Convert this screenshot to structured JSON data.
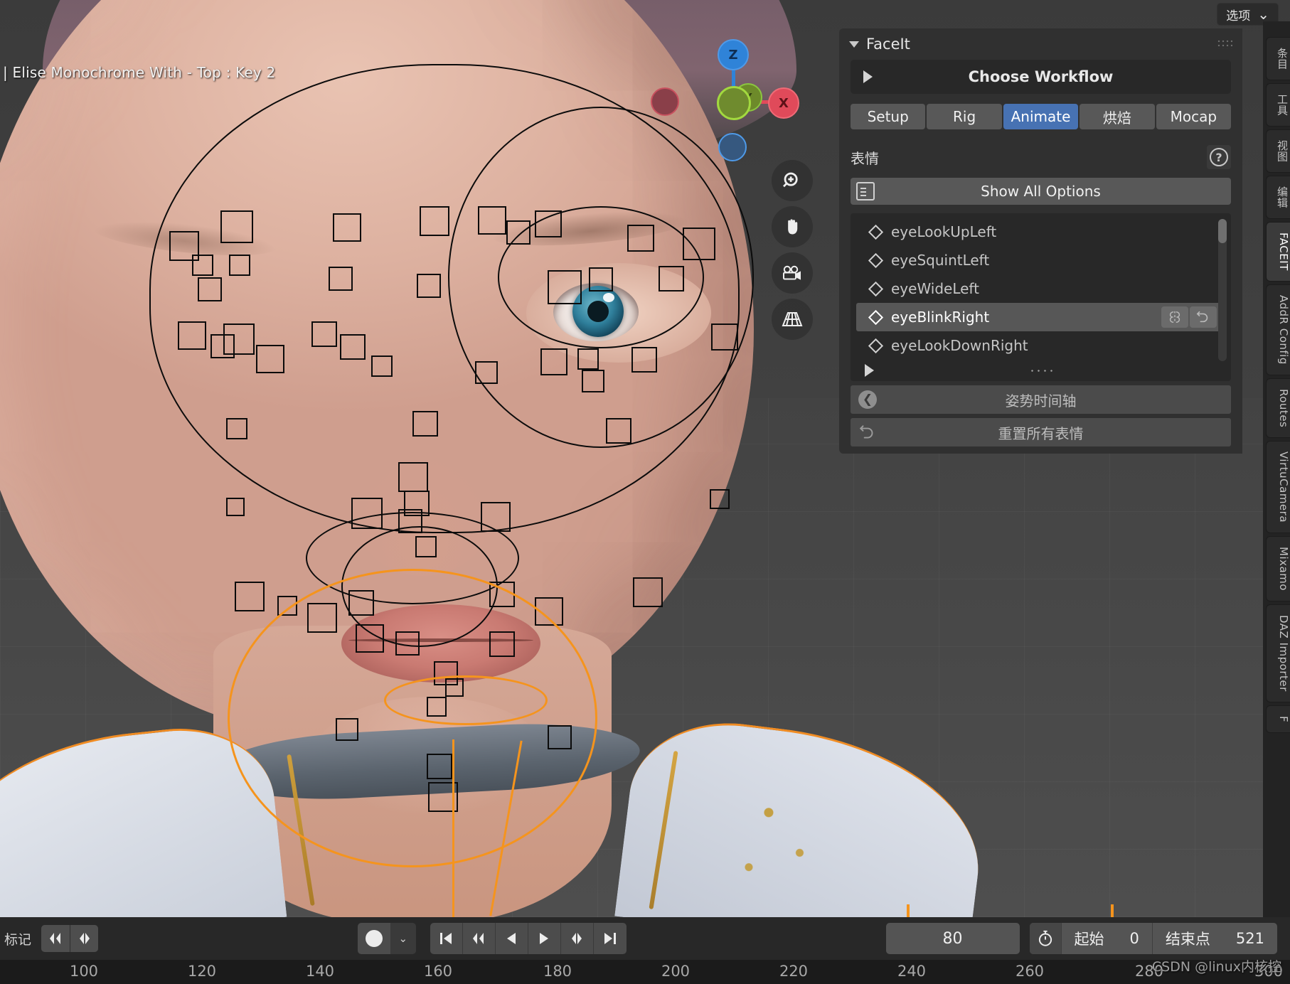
{
  "viewport": {
    "overlay_text": "| Elise Monochrome With - Top : Key 2",
    "gizmo": {
      "axis_z": "Z",
      "axis_y": "Y",
      "axis_x": "X",
      "color_z": "#2f83d8",
      "color_y": "#8bc63f",
      "color_x": "#e04a5a"
    },
    "nav_icons": [
      {
        "name": "zoom-icon",
        "glyph": "⌕"
      },
      {
        "name": "pan-hand-icon",
        "glyph": "✋"
      },
      {
        "name": "camera-view-icon",
        "glyph": "🎥"
      },
      {
        "name": "grid-perspective-icon",
        "glyph": "▦"
      }
    ]
  },
  "topbar": {
    "options_label": "选项",
    "options_chevron": "⌄"
  },
  "vertical_tabs": [
    {
      "label": "条目",
      "active": false
    },
    {
      "label": "工具",
      "active": false
    },
    {
      "label": "视图",
      "active": false
    },
    {
      "label": "编辑",
      "active": false
    },
    {
      "label": "FACEIT",
      "active": true
    },
    {
      "label": "AddR Config",
      "active": false
    },
    {
      "label": "Routes",
      "active": false
    },
    {
      "label": "VirtuCamera",
      "active": false
    },
    {
      "label": "Mixamo",
      "active": false
    },
    {
      "label": "DAZ Importer",
      "active": false
    },
    {
      "label": "F",
      "active": false
    }
  ],
  "panel": {
    "title": "FaceIt",
    "choose_workflow_label": "Choose Workflow",
    "tabs": [
      {
        "label": "Setup",
        "active": false
      },
      {
        "label": "Rig",
        "active": false
      },
      {
        "label": "Animate",
        "active": true
      },
      {
        "label": "烘焙",
        "active": false
      },
      {
        "label": "Mocap",
        "active": false
      }
    ],
    "section_title": "表情",
    "help_glyph": "?",
    "show_all_options_label": "Show All Options",
    "expressions": [
      {
        "label": "eyeLookUpLeft",
        "selected": false
      },
      {
        "label": "eyeSquintLeft",
        "selected": false
      },
      {
        "label": "eyeWideLeft",
        "selected": false
      },
      {
        "label": "eyeBlinkRight",
        "selected": true
      },
      {
        "label": "eyeLookDownRight",
        "selected": false
      }
    ],
    "row_buttons": [
      {
        "name": "mirror-icon",
        "glyph": "ΘΘ"
      },
      {
        "name": "reset-icon",
        "glyph": "↶"
      }
    ],
    "footer_buttons": [
      {
        "label": "姿势时间轴",
        "icon": "back-arrow-circle-icon"
      },
      {
        "label": "重置所有表情",
        "icon": "undo-arrow-icon"
      }
    ],
    "accent_color": "#4772b3"
  },
  "timeline": {
    "marker_label": "标记",
    "marker_buttons": [
      {
        "name": "jump-prev-marker-icon",
        "glyph": "◀◆"
      },
      {
        "name": "jump-next-marker-icon",
        "glyph": "◆▶"
      }
    ],
    "record_button": {
      "name": "auto-key-record-icon"
    },
    "record_dropdown": {
      "name": "record-options-chevron-icon",
      "glyph": "⌄"
    },
    "transport": [
      {
        "name": "jump-start-icon",
        "glyph": "|◀"
      },
      {
        "name": "prev-keyframe-icon",
        "glyph": "◀◆"
      },
      {
        "name": "play-reverse-icon",
        "glyph": "◀"
      },
      {
        "name": "play-icon",
        "glyph": "▶"
      },
      {
        "name": "next-keyframe-icon",
        "glyph": "◆▶"
      },
      {
        "name": "jump-end-icon",
        "glyph": "▶|"
      }
    ],
    "current_frame": "80",
    "range_icon": "stopwatch-icon",
    "start_label": "起始",
    "start_value": "0",
    "end_label": "结束点",
    "end_value": "521",
    "ruler_ticks": [
      "100",
      "120",
      "140",
      "160",
      "180",
      "200",
      "220",
      "240",
      "260",
      "280",
      "300"
    ]
  },
  "watermark": "CSDN @linux内核控"
}
